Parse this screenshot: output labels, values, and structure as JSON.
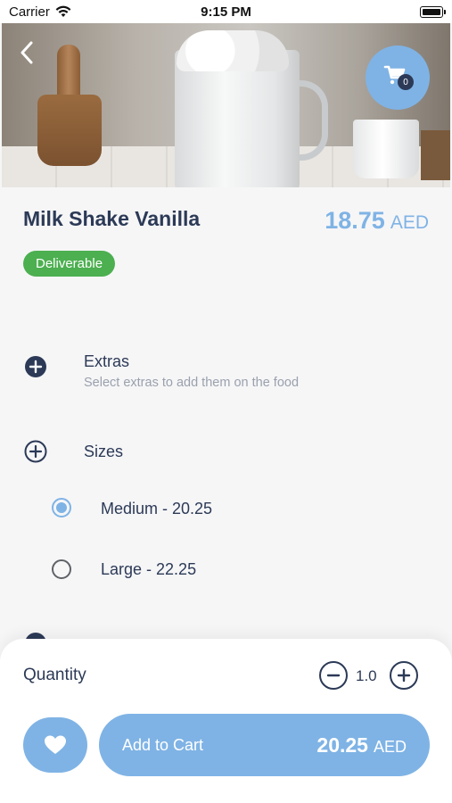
{
  "status_bar": {
    "carrier": "Carrier",
    "time": "9:15 PM"
  },
  "header": {
    "cart_count": "0"
  },
  "product": {
    "name": "Milk Shake Vanilla",
    "price": "18.75",
    "currency": "AED",
    "badge": "Deliverable"
  },
  "extras": {
    "title": "Extras",
    "subtitle": "Select extras to add them on the food"
  },
  "sizes": {
    "title": "Sizes",
    "options": [
      {
        "label": "Medium - 20.25",
        "selected": true
      },
      {
        "label": "Large - 22.25",
        "selected": false
      }
    ]
  },
  "bottom": {
    "quantity_label": "Quantity",
    "quantity_value": "1.0",
    "add_to_cart_label": "Add to Cart",
    "total_price": "20.25",
    "total_currency": "AED"
  },
  "colors": {
    "accent": "#7fb3e5",
    "text": "#2c3a57",
    "badge_green": "#4caf50"
  }
}
